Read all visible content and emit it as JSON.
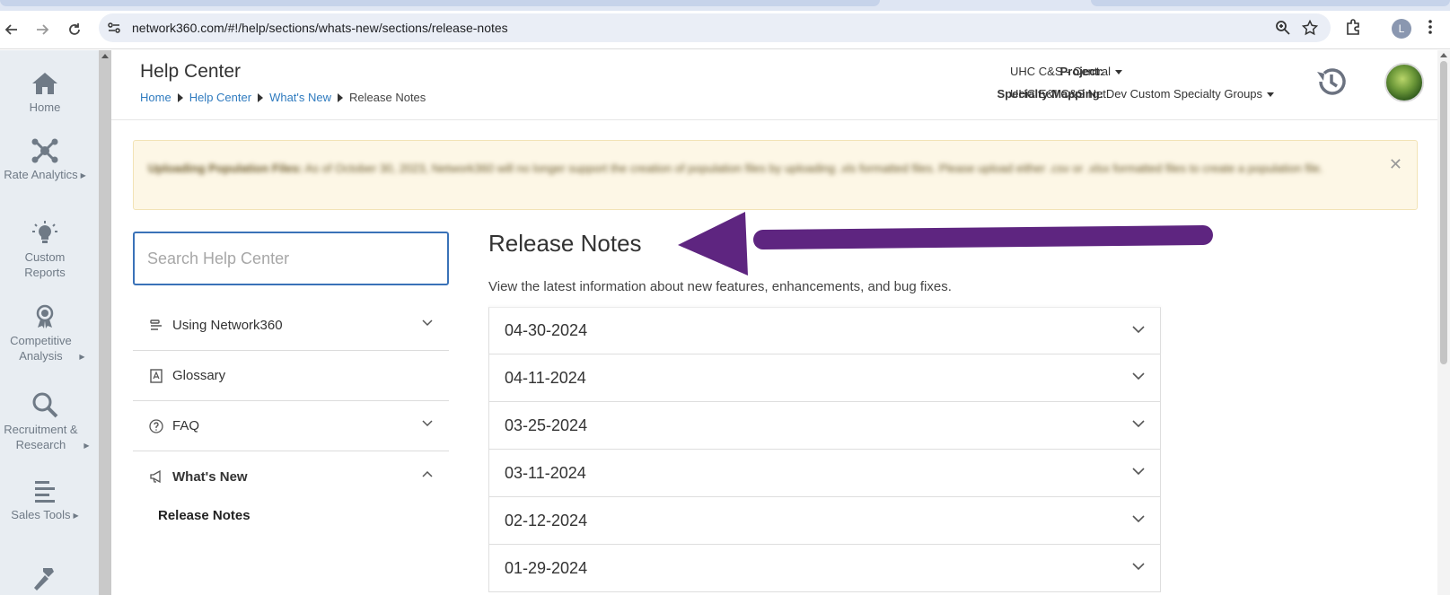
{
  "browser": {
    "url": "network360.com/#!/help/sections/whats-new/sections/release-notes",
    "profile_initial": "L"
  },
  "leftnav": {
    "items": [
      {
        "label": "Home",
        "icon": "home-icon",
        "has_submenu": false
      },
      {
        "label": "Rate Analytics",
        "icon": "network-icon",
        "has_submenu": true
      },
      {
        "label": "Custom Reports",
        "icon": "lightbulb-icon",
        "has_submenu": false
      },
      {
        "label": "Competitive Analysis",
        "icon": "award-icon",
        "has_submenu": true
      },
      {
        "label": "Recruitment & Research",
        "icon": "search-icon",
        "has_submenu": true
      },
      {
        "label": "Sales Tools",
        "icon": "list-icon",
        "has_submenu": true
      }
    ]
  },
  "header": {
    "title": "Help Center",
    "breadcrumb": [
      {
        "label": "Home",
        "link": true
      },
      {
        "label": "Help Center",
        "link": true
      },
      {
        "label": "What's New",
        "link": true
      },
      {
        "label": "Release Notes",
        "link": false
      }
    ],
    "project_label": "Project:",
    "project_value": "UHC C&S - Central",
    "specialty_label": "Specialty Mapping:",
    "specialty_value": "UHC E&I C&S NetDev Custom Specialty Groups"
  },
  "alert": {
    "title": "Uploading Population Files:",
    "body": "As of October 30, 2023, Network360 will no longer support the creation of population files by uploading .xls formatted files. Please upload either .csv or .xlsx formatted files to create a population file."
  },
  "search": {
    "placeholder": "Search Help Center"
  },
  "side_menu": {
    "items": [
      {
        "label": "Using Network360",
        "icon": "guide-icon",
        "expandable": true,
        "expanded": false
      },
      {
        "label": "Glossary",
        "icon": "book-icon",
        "expandable": false
      },
      {
        "label": "FAQ",
        "icon": "question-icon",
        "expandable": true,
        "expanded": false
      },
      {
        "label": "What's New",
        "icon": "megaphone-icon",
        "expandable": true,
        "expanded": true
      }
    ],
    "subitems": [
      "Release Notes"
    ]
  },
  "main": {
    "title": "Release Notes",
    "description": "View the latest information about new features, enhancements, and bug fixes.",
    "releases": [
      "04-30-2024",
      "04-11-2024",
      "03-25-2024",
      "03-11-2024",
      "02-12-2024",
      "01-29-2024"
    ]
  },
  "colors": {
    "link": "#2f7bbf",
    "arrow": "#5e2580",
    "alert_bg": "#fdf7e6",
    "nav_bg": "#e8edf2"
  }
}
